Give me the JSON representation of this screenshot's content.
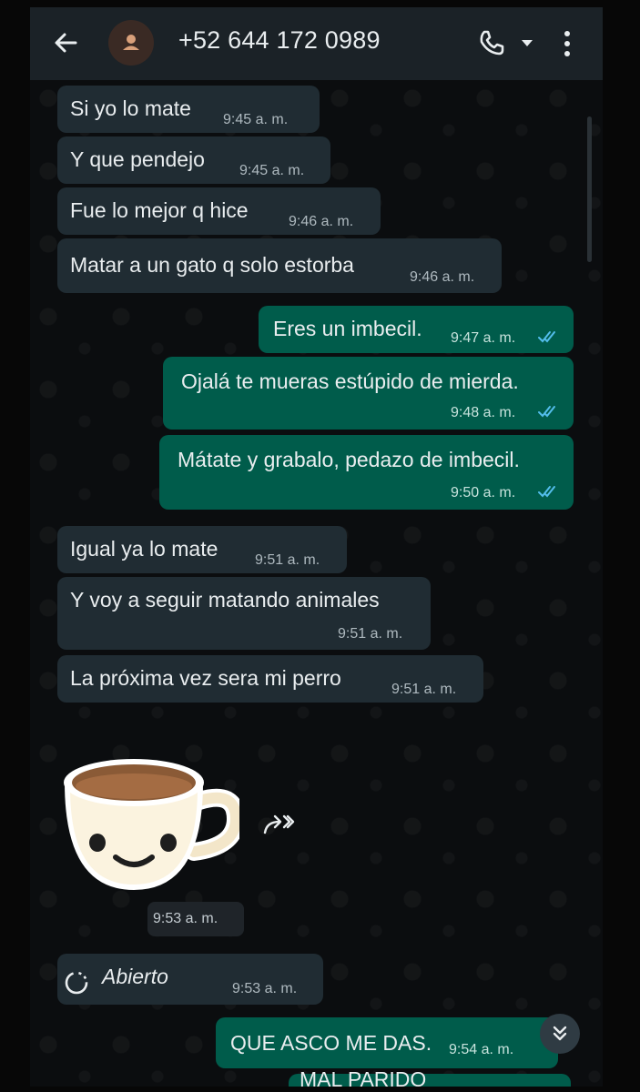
{
  "header": {
    "contact_name": "+52 644 172 0989",
    "icons": [
      "back-arrow-icon",
      "avatar-person-icon",
      "phone-call-icon",
      "dropdown-caret-icon",
      "more-vertical-icon"
    ]
  },
  "colors": {
    "incoming_bubble": "#202c33",
    "outgoing_bubble": "#005c4b",
    "header": "#1b2227",
    "read_ticks": "#53bdeb"
  },
  "messages": [
    {
      "dir": "in",
      "text": "Si yo lo mate",
      "time": "9:45 a. m."
    },
    {
      "dir": "in",
      "text": "Y que pendejo",
      "time": "9:45 a. m."
    },
    {
      "dir": "in",
      "text": "Fue lo mejor q hice",
      "time": "9:46 a. m."
    },
    {
      "dir": "in",
      "text": "Matar a un gato q solo estorba",
      "time": "9:46 a. m."
    },
    {
      "dir": "out",
      "text": "Eres un imbecil.",
      "time": "9:47 a. m."
    },
    {
      "dir": "out",
      "text": "Ojalá te mueras estúpido de mierda.",
      "time": "9:48 a. m."
    },
    {
      "dir": "out",
      "text": "Mátate y grabalo, pedazo de imbecil.",
      "time": "9:50 a. m."
    },
    {
      "dir": "in",
      "text": "Igual ya lo mate",
      "time": "9:51 a. m."
    },
    {
      "dir": "in",
      "text": "Y voy a seguir matando animales",
      "time": "9:51 a. m."
    },
    {
      "dir": "in",
      "text": "La próxima vez sera mi perro",
      "time": "9:51 a. m."
    },
    {
      "dir": "out",
      "text": "QUE ASCO ME DAS.",
      "time": "9:54 a. m."
    },
    {
      "dir": "out",
      "text": "MAL PARIDO",
      "time": ""
    }
  ],
  "sticker": {
    "name": "smiling-coffee-cup-sticker",
    "time": "9:53 a. m."
  },
  "view_once": {
    "label": "Abierto",
    "time": "9:53 a. m."
  }
}
